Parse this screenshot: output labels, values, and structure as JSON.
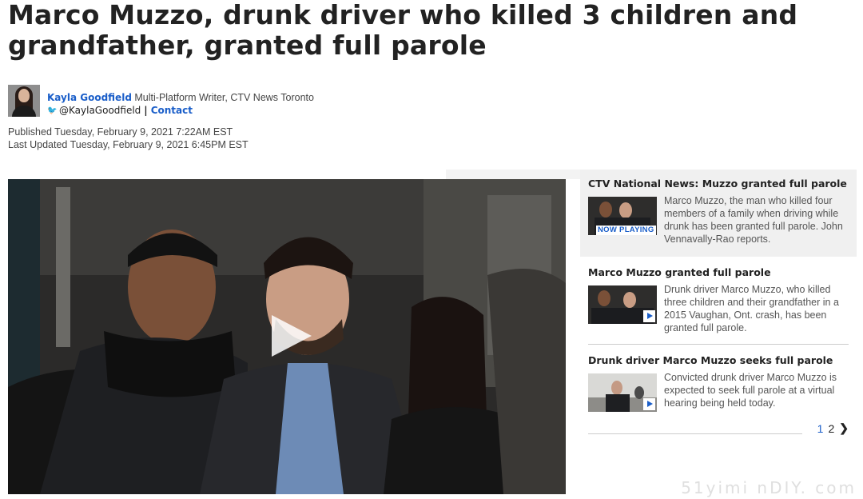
{
  "article": {
    "headline": "Marco Muzzo, drunk driver who killed 3 children and grandfather, granted full parole",
    "author": {
      "name": "Kayla Goodfield",
      "role": "Multi-Platform Writer, CTV News Toronto",
      "twitter": "@KaylaGoodfield",
      "separator": "|",
      "contact_label": "Contact"
    },
    "published": "Published Tuesday, February 9, 2021 7:22AM EST",
    "updated": "Last Updated Tuesday, February 9, 2021 6:45PM EST"
  },
  "playlist": {
    "items": [
      {
        "title": "CTV National News: Muzzo granted full parole",
        "description": "Marco Muzzo, the man who killed four members of a family when driving while drunk has been granted full parole. John Vennavally-Rao reports.",
        "badge": "NOW PLAYING"
      },
      {
        "title": "Marco Muzzo granted full parole",
        "description": "Drunk driver Marco Muzzo, who killed three children and their grandfather in a 2015 Vaughan, Ont. crash, has been granted full parole."
      },
      {
        "title": "Drunk driver Marco Muzzo seeks full parole",
        "description": "Convicted drunk driver Marco Muzzo is expected to seek full parole at a virtual hearing being held today."
      }
    ],
    "pages": [
      "1",
      "2"
    ],
    "next_label": "❯"
  },
  "watermark": "51yimi nDIY. com",
  "colors": {
    "link": "#1a5ec9",
    "headline": "#222222",
    "active_bg": "#f0f0f0"
  }
}
